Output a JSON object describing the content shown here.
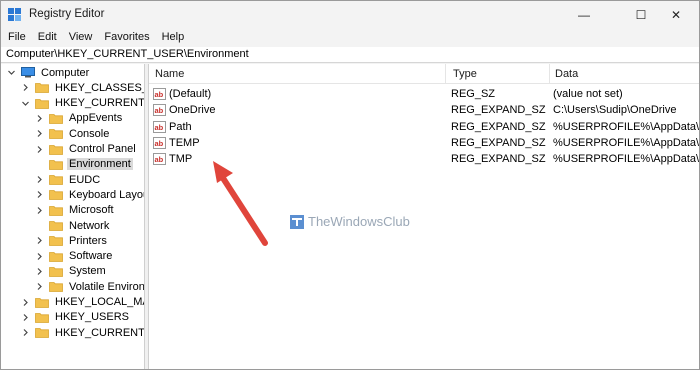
{
  "window": {
    "title": "Registry Editor",
    "buttons": {
      "minimize": "—",
      "maximize": "☐",
      "close": "✕"
    }
  },
  "menu": [
    "File",
    "Edit",
    "View",
    "Favorites",
    "Help"
  ],
  "address": "Computer\\HKEY_CURRENT_USER\\Environment",
  "tree": [
    {
      "label": "Computer",
      "level": 0,
      "expander": "expanded",
      "icon": "computer-icon"
    },
    {
      "label": "HKEY_CLASSES_ROOT",
      "level": 1,
      "expander": "collapsed",
      "icon": "folder-icon"
    },
    {
      "label": "HKEY_CURRENT_USER",
      "level": 1,
      "expander": "expanded",
      "icon": "folder-icon"
    },
    {
      "label": "AppEvents",
      "level": 2,
      "expander": "collapsed",
      "icon": "folder-icon"
    },
    {
      "label": "Console",
      "level": 2,
      "expander": "collapsed",
      "icon": "folder-icon"
    },
    {
      "label": "Control Panel",
      "level": 2,
      "expander": "collapsed",
      "icon": "folder-icon"
    },
    {
      "label": "Environment",
      "level": 2,
      "expander": "none",
      "icon": "folder-icon",
      "selected": true
    },
    {
      "label": "EUDC",
      "level": 2,
      "expander": "collapsed",
      "icon": "folder-icon"
    },
    {
      "label": "Keyboard Layout",
      "level": 2,
      "expander": "collapsed",
      "icon": "folder-icon"
    },
    {
      "label": "Microsoft",
      "level": 2,
      "expander": "collapsed",
      "icon": "folder-icon"
    },
    {
      "label": "Network",
      "level": 2,
      "expander": "none",
      "icon": "folder-icon"
    },
    {
      "label": "Printers",
      "level": 2,
      "expander": "collapsed",
      "icon": "folder-icon"
    },
    {
      "label": "Software",
      "level": 2,
      "expander": "collapsed",
      "icon": "folder-icon"
    },
    {
      "label": "System",
      "level": 2,
      "expander": "collapsed",
      "icon": "folder-icon"
    },
    {
      "label": "Volatile Environment",
      "level": 2,
      "expander": "collapsed",
      "icon": "folder-icon"
    },
    {
      "label": "HKEY_LOCAL_MACHINE",
      "level": 1,
      "expander": "collapsed",
      "icon": "folder-icon"
    },
    {
      "label": "HKEY_USERS",
      "level": 1,
      "expander": "collapsed",
      "icon": "folder-icon"
    },
    {
      "label": "HKEY_CURRENT_CONFIG",
      "level": 1,
      "expander": "collapsed",
      "icon": "folder-icon"
    }
  ],
  "list": {
    "columns": [
      "Name",
      "Type",
      "Data"
    ],
    "rows": [
      {
        "name": "(Default)",
        "type": "REG_SZ",
        "data": "(value not set)"
      },
      {
        "name": "OneDrive",
        "type": "REG_EXPAND_SZ",
        "data": "C:\\Users\\Sudip\\OneDrive"
      },
      {
        "name": "Path",
        "type": "REG_EXPAND_SZ",
        "data": "%USERPROFILE%\\AppData\\Local"
      },
      {
        "name": "TEMP",
        "type": "REG_EXPAND_SZ",
        "data": "%USERPROFILE%\\AppData\\Local"
      },
      {
        "name": "TMP",
        "type": "REG_EXPAND_SZ",
        "data": "%USERPROFILE%\\AppData\\Local"
      }
    ]
  },
  "watermark": "TheWindowsClub",
  "colors": {
    "arrow": "#e0453b",
    "folder": "#f2c14e",
    "selection": "#d9d9d9",
    "ab_icon": "#c8302c"
  }
}
